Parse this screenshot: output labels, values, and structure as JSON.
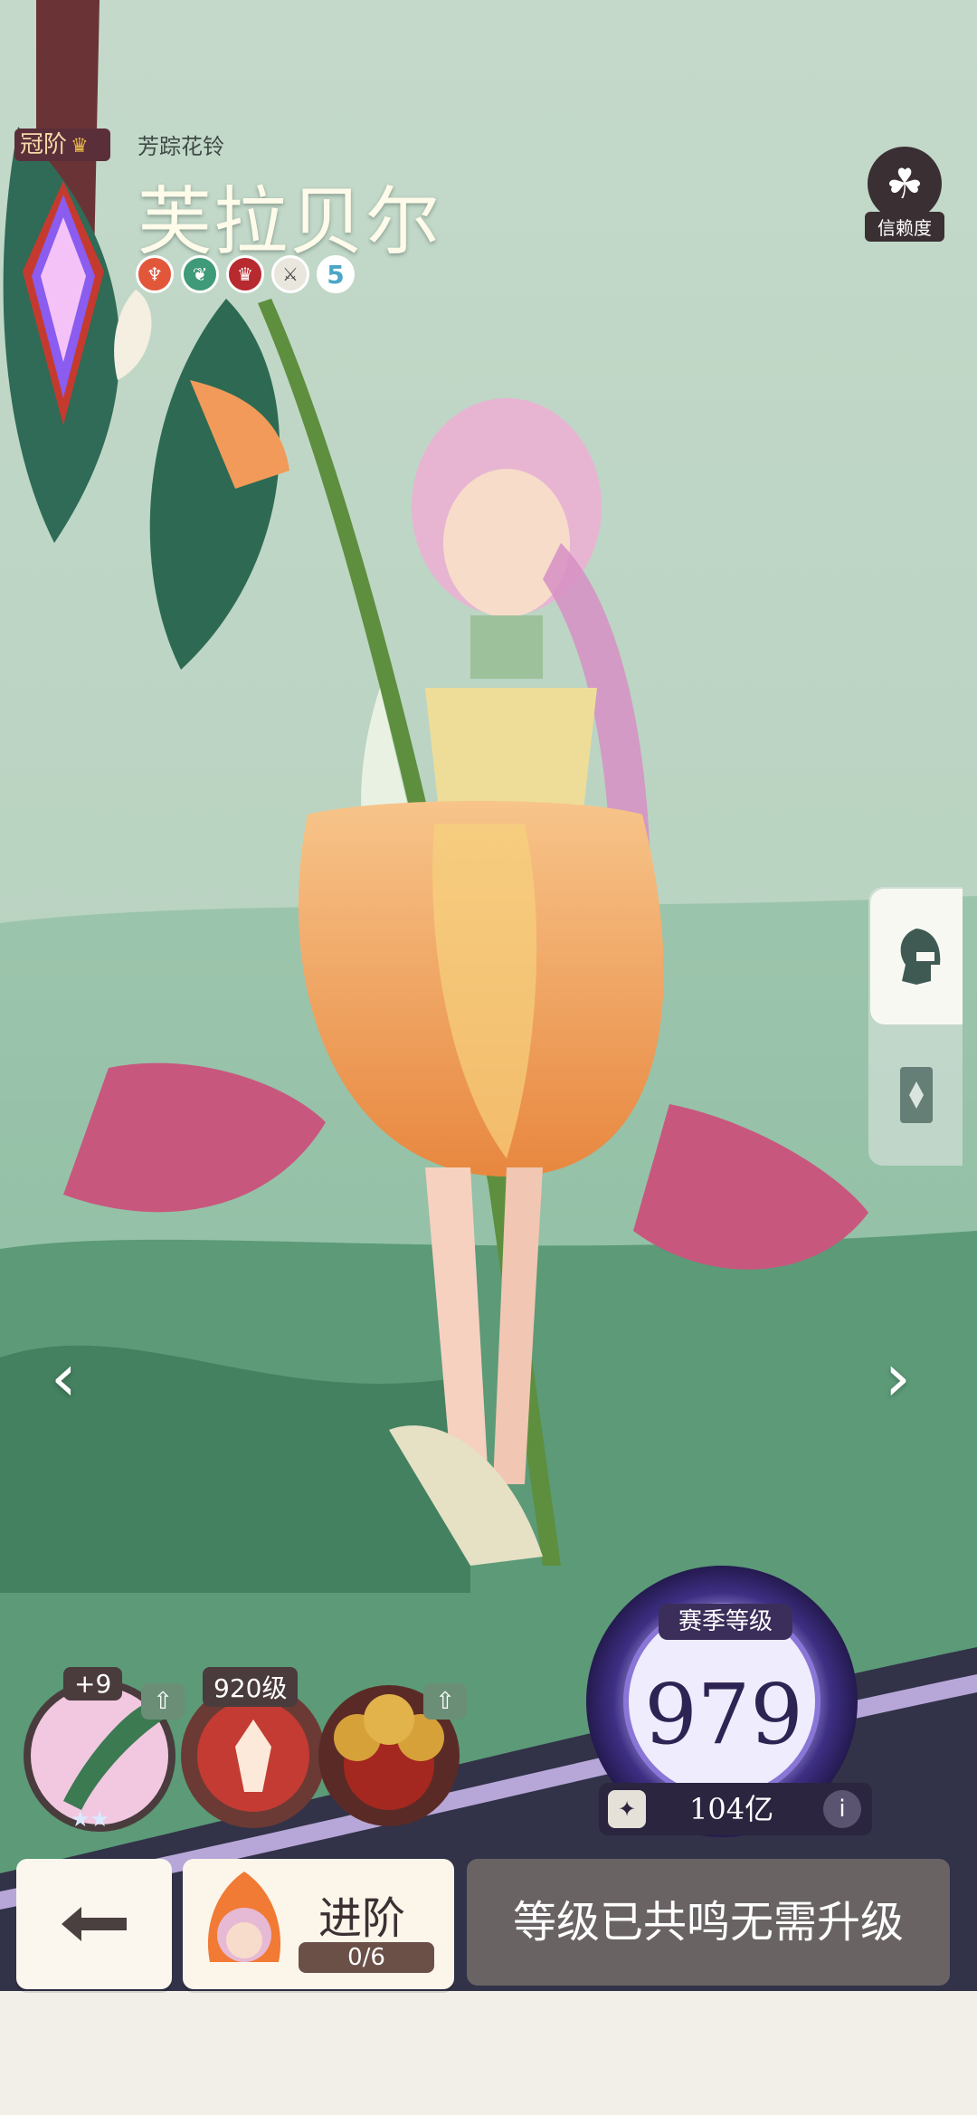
{
  "rank": {
    "tier_label": "冠阶"
  },
  "hero": {
    "subtitle": "芳踪花铃",
    "name": "芙拉贝尔",
    "element_count": "5"
  },
  "trust": {
    "label": "信赖度"
  },
  "equipment": {
    "skin_plus": "+9",
    "weapon_level": "920级"
  },
  "season": {
    "label": "赛季等级",
    "level": "979",
    "currency_value": "104亿",
    "info_icon": "i"
  },
  "actions": {
    "advance_label": "进阶",
    "advance_progress": "0/6",
    "status_text": "等级已共鸣无需升级"
  },
  "icons": {
    "back": "back-arrow-icon",
    "nav_prev": "chevron-left-icon",
    "nav_next": "chevron-right-icon",
    "trust": "clover-icon",
    "helmet": "helmet-icon",
    "card": "card-icon"
  }
}
